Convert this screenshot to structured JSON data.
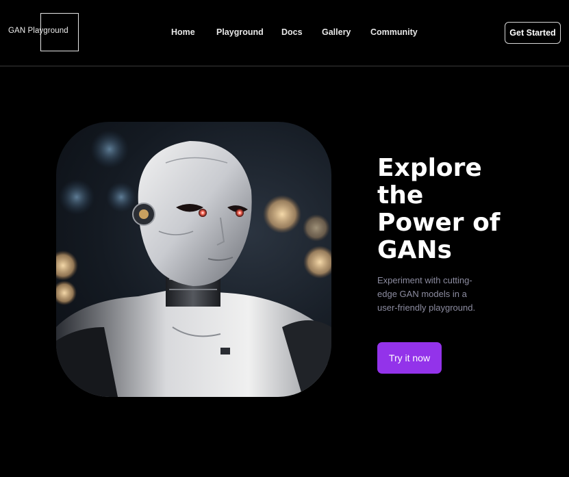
{
  "brand": {
    "logo_text": "GAN Playground"
  },
  "nav": {
    "items": [
      {
        "label": "Home"
      },
      {
        "label": "Playground"
      },
      {
        "label": "Docs"
      },
      {
        "label": "Gallery"
      },
      {
        "label": "Community"
      }
    ],
    "cta_label": "Get Started"
  },
  "hero": {
    "headline": "Explore the Power of GANs",
    "subtext": "Experiment with cutting-edge GAN models in a user-friendly playground.",
    "button_label": "Try it now",
    "image_alt": "humanoid-robot-portrait"
  },
  "colors": {
    "background": "#000000",
    "accent": "#9333ea",
    "muted_text": "#8c8ca0",
    "divider": "#3a3a3a"
  }
}
